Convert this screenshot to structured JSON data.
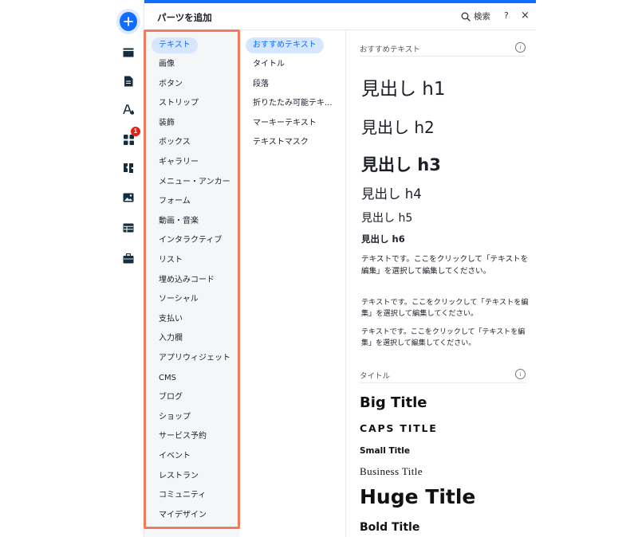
{
  "panel": {
    "title": "パーツを追加",
    "search_label": "検索",
    "help_label": "?",
    "close_label": "×"
  },
  "rail": {
    "icons": [
      "add-icon",
      "section-icon",
      "page-icon",
      "theme-icon",
      "apps-icon",
      "add-apps-icon",
      "media-icon",
      "cms-icon",
      "portfolio-icon"
    ],
    "apps_badge": "1"
  },
  "categories": [
    "テキスト",
    "画像",
    "ボタン",
    "ストリップ",
    "装飾",
    "ボックス",
    "ギャラリー",
    "メニュー・アンカー",
    "フォーム",
    "動画・音楽",
    "インタラクティブ",
    "リスト",
    "埋め込みコード",
    "ソーシャル",
    "支払い",
    "入力欄",
    "アプリウィジェット",
    "CMS",
    "ブログ",
    "ショップ",
    "サービス予約",
    "イベント",
    "レストラン",
    "コミュニティ",
    "マイデザイン"
  ],
  "subcategories": [
    "おすすめテキスト",
    "タイトル",
    "段落",
    "折りたたみ可能テキ...",
    "マーキーテキスト",
    "テキストマスク"
  ],
  "content": {
    "section_recommended": "おすすめテキスト",
    "headings": [
      "見出し h1",
      "見出し h2",
      "見出し h3",
      "見出し h4",
      "見出し h5",
      "見出し h6"
    ],
    "paragraphs": [
      "テキストです。ここをクリックして「テキストを編集」を選択して編集してください。",
      "テキストです。ここをクリックして「テキストを編集」を選択して編集してください。",
      "テキストです。ここをクリックして「テキストを編集」を選択して編集してください。"
    ],
    "section_titles": "タイトル",
    "titles": [
      "Big Title",
      "CAPS TITLE",
      "Small Title",
      "Business Title",
      "Huge Title",
      "Bold Title"
    ]
  },
  "colors": {
    "accent": "#116dff",
    "highlight_border": "#f47a5d",
    "active_bg": "#d6e6fe",
    "badge": "#e62214"
  }
}
